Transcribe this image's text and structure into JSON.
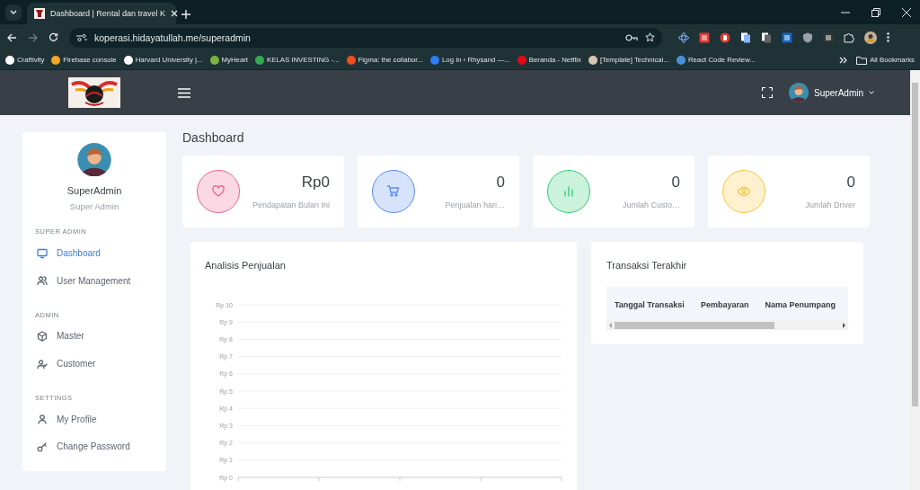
{
  "browser": {
    "tabs": [
      {
        "title": "Dashboard | Rental dan travel K",
        "selected": true
      }
    ],
    "url": "koperasi.hidayatullah.me/superadmin",
    "bookmarks": [
      {
        "label": "Craftivity",
        "color": "#ffffff"
      },
      {
        "label": "Firebase console",
        "color": "#f5a623"
      },
      {
        "label": "Harvard University |...",
        "color": "#ffffff"
      },
      {
        "label": "MyHeart",
        "color": "#7cb342"
      },
      {
        "label": "KELAS INVESTING -...",
        "color": "#34a853"
      },
      {
        "label": "Figma: the collabor...",
        "color": "#f24e1e"
      },
      {
        "label": "Log In ‹ Rhysand —...",
        "color": "#2f7bf5"
      },
      {
        "label": "Beranda - Netflix",
        "color": "#e50914"
      },
      {
        "label": "[Template] Technical...",
        "color": "#d9c6b0"
      },
      {
        "label": "React Code Review...",
        "color": "#4a90d9"
      }
    ],
    "all_bookmarks": "All Bookmarks"
  },
  "header": {
    "user_name": "SuperAdmin"
  },
  "profile": {
    "name": "SuperAdmin",
    "role": "Super Admin"
  },
  "sidebar": {
    "sections": [
      {
        "heading": "SUPER ADMIN",
        "items": [
          {
            "label": "Dashboard",
            "kind": "monitor",
            "selected": true
          },
          {
            "label": "User Management",
            "kind": "users",
            "selected": false
          }
        ]
      },
      {
        "heading": "ADMIN",
        "items": [
          {
            "label": "Master",
            "kind": "box",
            "selected": false
          },
          {
            "label": "Customer",
            "kind": "user-check",
            "selected": false
          }
        ]
      },
      {
        "heading": "SETTINGS",
        "items": [
          {
            "label": "My Profile",
            "kind": "user",
            "selected": false
          },
          {
            "label": "Change Password",
            "kind": "key",
            "selected": false
          }
        ]
      }
    ]
  },
  "page_title": "Dashboard",
  "stats": [
    {
      "value": "Rp0",
      "label": "Pendapatan Bulan Ini",
      "kind": "heart",
      "color": "#f06292"
    },
    {
      "value": "0",
      "label": "Penjualan hari…",
      "kind": "cart",
      "color": "#5b8def"
    },
    {
      "value": "0",
      "label": "Jumlah Custo…",
      "kind": "chart",
      "color": "#2ecc71"
    },
    {
      "value": "0",
      "label": "Jumlah Driver",
      "kind": "eye",
      "color": "#f5c542"
    }
  ],
  "sales_chart": {
    "title": "Analisis Penjualan",
    "y_axis_labels": [
      "Rp 10",
      "Rp 9",
      "Rp 8",
      "Rp 7",
      "Rp 6",
      "Rp 5",
      "Rp 4",
      "Rp 3",
      "Rp 2",
      "Rp 1",
      "Rp 0"
    ]
  },
  "transactions": {
    "title": "Transaksi Terakhir",
    "columns": [
      "Tanggal Transaksi",
      "Pembayaran",
      "Nama Penumpang"
    ]
  }
}
